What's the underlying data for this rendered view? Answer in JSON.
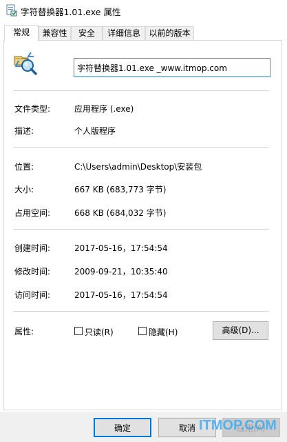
{
  "window": {
    "title": "字符替换器1.01.exe 属性",
    "icon": "file-properties-icon"
  },
  "tabs": [
    {
      "label": "常规",
      "active": true
    },
    {
      "label": "兼容性",
      "active": false
    },
    {
      "label": "安全",
      "active": false
    },
    {
      "label": "详细信息",
      "active": false
    },
    {
      "label": "以前的版本",
      "active": false
    }
  ],
  "general": {
    "file_icon": "text-replace-icon",
    "filename": "字符替换器1.01.exe _www.itmop.com",
    "type_label": "文件类型:",
    "type_value": "应用程序 (.exe)",
    "desc_label": "描述:",
    "desc_value": "个人版程序",
    "location_label": "位置:",
    "location_value": "C:\\Users\\admin\\Desktop\\安装包",
    "size_label": "大小:",
    "size_value": "667 KB (683,773 字节)",
    "disk_label": "占用空间:",
    "disk_value": "668 KB (684,032 字节)",
    "created_label": "创建时间:",
    "created_value": "2017-05-16，17:54:54",
    "modified_label": "修改时间:",
    "modified_value": "2009-09-21，10:35:40",
    "accessed_label": "访问时间:",
    "accessed_value": "2017-05-16，17:54:54",
    "attr_label": "属性:",
    "readonly_label": "只读(R)",
    "readonly_checked": false,
    "hidden_label": "隐藏(H)",
    "hidden_checked": false,
    "advanced_button": "高级(D)..."
  },
  "footer": {
    "ok": "确定",
    "cancel": "取消",
    "apply": "应用(A)",
    "apply_disabled": true
  },
  "watermark": "ITMOP.COM",
  "colors": {
    "accent": "#0078d7",
    "watermark": "#3fa9f5"
  }
}
